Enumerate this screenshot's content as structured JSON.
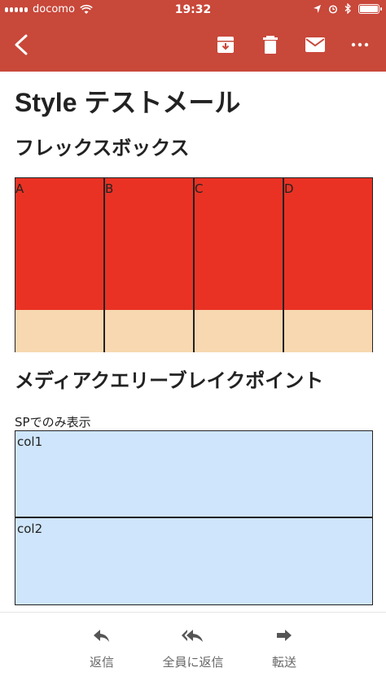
{
  "status_bar": {
    "carrier": "docomo",
    "time": "19:32"
  },
  "toolbar": {
    "icons": [
      "back-arrow-icon",
      "archive-icon",
      "trash-icon",
      "mail-icon",
      "more-icon"
    ]
  },
  "email": {
    "title": "Style テストメール",
    "section_flex": "フレックスボックス",
    "flex_cells": [
      {
        "label": "A"
      },
      {
        "label": "B"
      },
      {
        "label": "C"
      },
      {
        "label": "D"
      }
    ],
    "section_media": "メディアクエリーブレイクポイント",
    "sp_label": "SPでのみ表示",
    "cols": [
      {
        "label": "col1"
      },
      {
        "label": "col2"
      }
    ]
  },
  "actions": {
    "reply": "返信",
    "reply_all": "全員に返信",
    "forward": "転送"
  },
  "colors": {
    "header": "#c8483a",
    "flex_top": "#e93224",
    "flex_bottom": "#f7d8b0",
    "cols_bg": "#cfe5fb"
  }
}
